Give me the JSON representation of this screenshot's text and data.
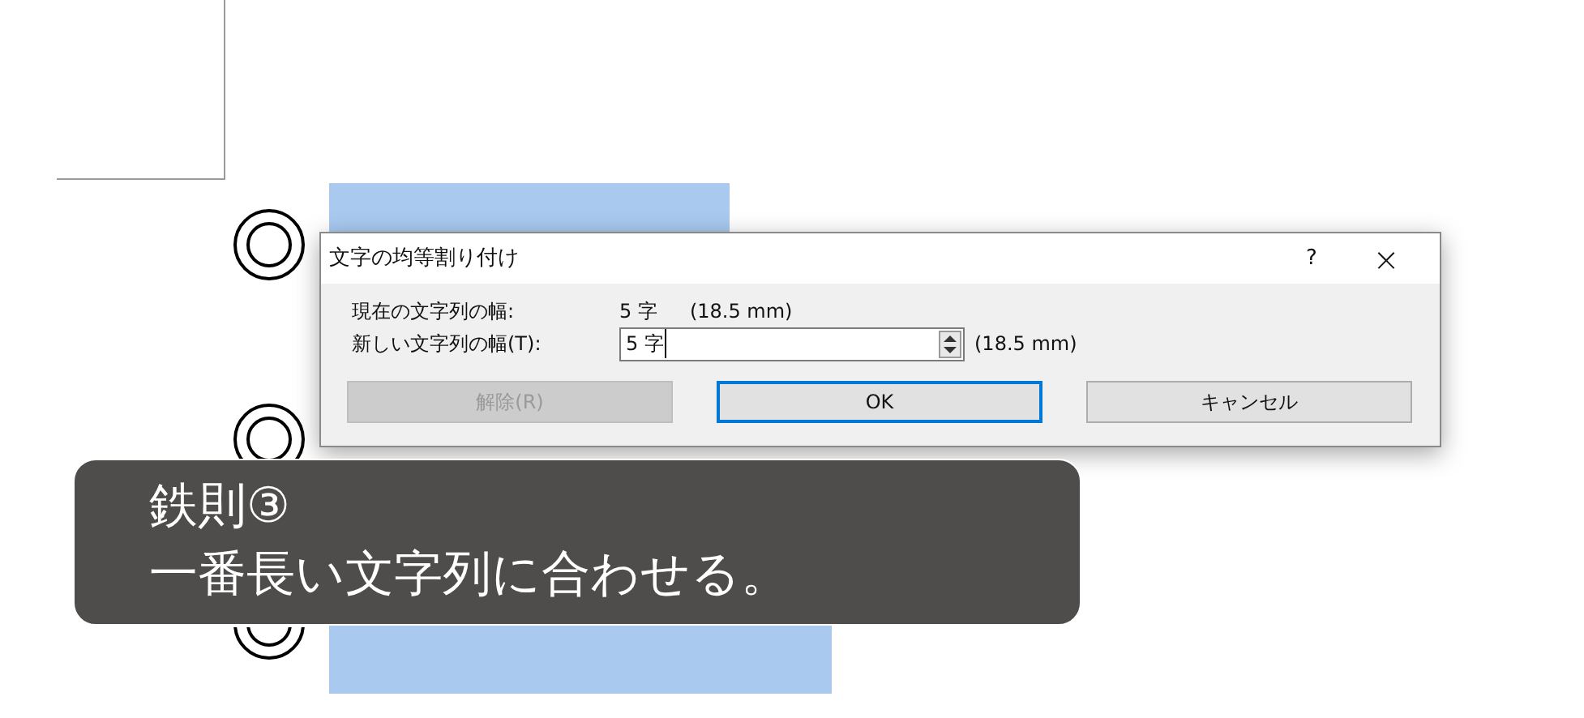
{
  "dialog": {
    "title": "文字の均等割り付け",
    "help": "?",
    "close": "×",
    "current_label": "現在の文字列の幅:",
    "current_value": "5 字",
    "current_mm": "(18.5 mm)",
    "new_label": "新しい文字列の幅(T):",
    "new_value": "5 字",
    "new_mm": "(18.5 mm)",
    "buttons": [
      {
        "label": "解除(R)",
        "disabled": true,
        "default": false
      },
      {
        "label": "OK",
        "disabled": false,
        "default": true
      },
      {
        "label": "キャンセル",
        "disabled": false,
        "default": false
      }
    ]
  },
  "caption": {
    "lines": [
      "鉄則③",
      "一番長い文字列に合わせる。"
    ]
  }
}
